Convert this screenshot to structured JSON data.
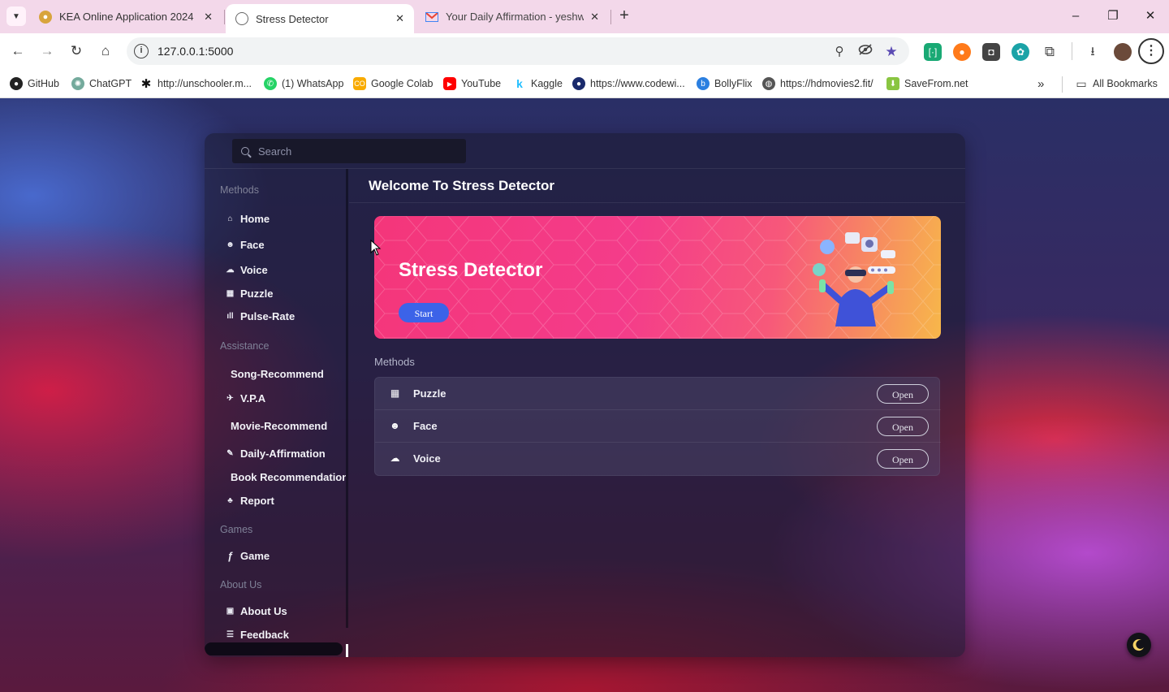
{
  "browser": {
    "tabs": [
      {
        "title": "KEA Online Application 2024",
        "active": false
      },
      {
        "title": "Stress Detector",
        "active": true
      },
      {
        "title": "Your Daily Affirmation - yeshwa",
        "active": false
      }
    ],
    "url": "127.0.0.1:5000",
    "bookmarks": [
      {
        "label": "GitHub",
        "icon": "github-icon"
      },
      {
        "label": "ChatGPT",
        "icon": "chatgpt-icon"
      },
      {
        "label": "http://unschooler.m...",
        "icon": "asterisk-icon"
      },
      {
        "label": "(1) WhatsApp",
        "icon": "whatsapp-icon"
      },
      {
        "label": "Google Colab",
        "icon": "colab-icon"
      },
      {
        "label": "YouTube",
        "icon": "youtube-icon"
      },
      {
        "label": "Kaggle",
        "icon": "kaggle-icon"
      },
      {
        "label": "https://www.codewi...",
        "icon": "codewithharry-icon"
      },
      {
        "label": "BollyFlix",
        "icon": "bollyflix-icon"
      },
      {
        "label": "https://hdmovies2.fit/",
        "icon": "globe-icon"
      },
      {
        "label": "SaveFrom.net",
        "icon": "savefrom-icon"
      }
    ],
    "all_bookmarks": "All Bookmarks"
  },
  "app": {
    "search_placeholder": "Search",
    "sidebar": {
      "groups": [
        {
          "title": "Methods",
          "items": [
            {
              "label": "Home",
              "icon": "home-icon"
            },
            {
              "label": "Face",
              "icon": "face-icon"
            },
            {
              "label": "Voice",
              "icon": "voice-icon"
            },
            {
              "label": "Puzzle",
              "icon": "puzzle-icon"
            },
            {
              "label": "Pulse-Rate",
              "icon": "chart-icon"
            }
          ]
        },
        {
          "title": "Assistance",
          "items": [
            {
              "label": "Song-Recommend",
              "icon": ""
            },
            {
              "label": "V.P.A",
              "icon": "assistant-icon"
            },
            {
              "label": "Movie-Recommend",
              "icon": ""
            },
            {
              "label": "Daily-Affirmation",
              "icon": "pencil-icon"
            },
            {
              "label": "Book Recommendation",
              "icon": ""
            },
            {
              "label": "Report",
              "icon": "report-icon"
            }
          ]
        },
        {
          "title": "Games",
          "items": [
            {
              "label": "Game",
              "icon": "function-icon"
            }
          ]
        },
        {
          "title": "About Us",
          "items": [
            {
              "label": "About Us",
              "icon": "about-icon"
            },
            {
              "label": "Feedback",
              "icon": "feedback-icon"
            }
          ]
        }
      ]
    },
    "header": {
      "title": "Welcome To Stress Detector"
    },
    "hero": {
      "title": "Stress Detector",
      "button": "Start"
    },
    "methods": {
      "title": "Methods",
      "rows": [
        {
          "label": "Puzzle",
          "button": "Open",
          "icon": "puzzle-icon"
        },
        {
          "label": "Face",
          "button": "Open",
          "icon": "face-icon"
        },
        {
          "label": "Voice",
          "button": "Open",
          "icon": "voice-icon"
        }
      ]
    }
  },
  "colors": {
    "hero_start": "#f4367a",
    "hero_end": "#f7b74a",
    "start_button": "#3c63e8"
  }
}
